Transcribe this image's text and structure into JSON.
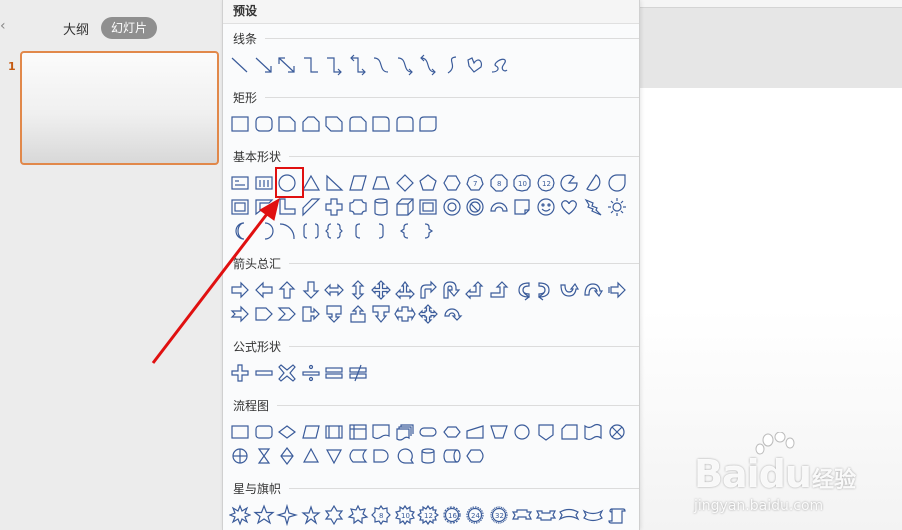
{
  "left_panel": {
    "tab_outline": "大纲",
    "tab_slides": "幻灯片",
    "slide_number": "1"
  },
  "shapes_panel": {
    "title": "预设",
    "sections": {
      "lines": "线条",
      "rectangles": "矩形",
      "basic_shapes": "基本形状",
      "arrows": "箭头总汇",
      "equations": "公式形状",
      "flowchart": "流程图",
      "stars_banners": "星与旗帜"
    },
    "number_badges": [
      "7",
      "8",
      "10",
      "12"
    ],
    "star_badges": [
      "8",
      "10",
      "12",
      "16",
      "24",
      "32"
    ],
    "selected_shape": "oval"
  },
  "watermark": {
    "brand": "Baidu",
    "brand_cn": "经验",
    "url": "jingyan.baidu.com"
  },
  "colors": {
    "shape_stroke": "#3a5b9a",
    "highlight": "#e01010",
    "slide_border": "#e1884a"
  }
}
